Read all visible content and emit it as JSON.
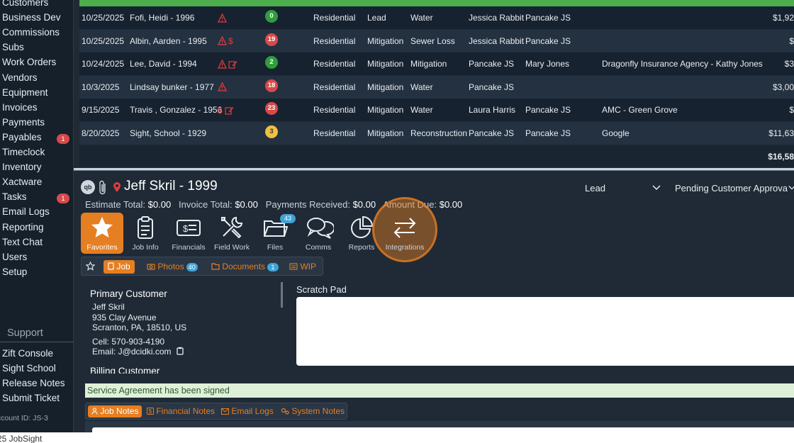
{
  "sidebar": {
    "items": [
      {
        "label": "Customers"
      },
      {
        "label": "Business Dev"
      },
      {
        "label": "Commissions"
      },
      {
        "label": "Subs"
      },
      {
        "label": "Work Orders"
      },
      {
        "label": "Vendors"
      },
      {
        "label": "Equipment"
      },
      {
        "label": "Invoices"
      },
      {
        "label": "Payments"
      },
      {
        "label": "Payables",
        "badge": "1"
      },
      {
        "label": "Timeclock"
      },
      {
        "label": "Inventory"
      },
      {
        "label": "Xactware"
      },
      {
        "label": "Tasks",
        "badge": "1"
      },
      {
        "label": "Email Logs"
      },
      {
        "label": "Reporting"
      },
      {
        "label": "Text Chat"
      },
      {
        "label": "Users"
      },
      {
        "label": "Setup"
      }
    ],
    "support_heading": "Support",
    "support_items": [
      "Zift Console",
      "Sight School",
      "Release Notes",
      "Submit Ticket"
    ],
    "account_id": "ccount ID:  JS-3"
  },
  "footer": {
    "text": "25 JobSight"
  },
  "table": {
    "rows": [
      {
        "date": "10/25/2025",
        "name": "Fofi, Heidi - 1996",
        "count": "0",
        "count_color": "#2e9e3a",
        "type": "Residential",
        "stage": "Lead",
        "loss": "Water",
        "rep1": "Jessica Rabbit",
        "rep2": "Pancake JS",
        "carrier": "",
        "amount": "$1,92"
      },
      {
        "date": "10/25/2025",
        "name": "Albin, Aarden - 1995",
        "count": "19",
        "count_color": "#d84a4a",
        "type": "Residential",
        "stage": "Mitigation",
        "loss": "Sewer Loss",
        "rep1": "Jessica Rabbit",
        "rep2": "Pancake JS",
        "carrier": "",
        "amount": "$"
      },
      {
        "date": "10/24/2025",
        "name": "Lee, David - 1994",
        "count": "2",
        "count_color": "#2e9e3a",
        "type": "Residential",
        "stage": "Mitigation",
        "loss": "Mitigation",
        "rep1": "Pancake JS",
        "rep2": "Mary Jones",
        "carrier": "Dragonfly Insurance Agency - Kathy Jones",
        "amount": "$3"
      },
      {
        "date": "10/3/2025",
        "name": "Lindsay bunker - 1977",
        "count": "18",
        "count_color": "#d84a4a",
        "type": "Residential",
        "stage": "Mitigation",
        "loss": "Water",
        "rep1": "Pancake JS",
        "rep2": "",
        "carrier": "",
        "amount": "$3,00"
      },
      {
        "date": "9/15/2025",
        "name": "Travis , Gonzalez - 1956",
        "count": "23",
        "count_color": "#d84a4a",
        "type": "Residential",
        "stage": "Mitigation",
        "loss": "Water",
        "rep1": "Laura Harris",
        "rep2": "Pancake JS",
        "carrier": "AMC - Green Grove",
        "amount": "$"
      },
      {
        "date": "8/20/2025",
        "name": "Sight, School - 1929",
        "count": "3",
        "count_color": "#f0c040",
        "type": "Residential",
        "stage": "Mitigation",
        "loss": "Reconstruction",
        "rep1": "Pancake JS",
        "rep2": "Pancake JS",
        "carrier": "Google",
        "amount": "$11,63"
      }
    ],
    "grand_total": "$16,58"
  },
  "job": {
    "title": "Jeff Skril - 1999",
    "qb_label": "qb",
    "status_select": "Lead",
    "substatus_select": "Pending Customer Approva",
    "estimate_label": "Estimate Total:",
    "estimate_value": "$0.00",
    "invoice_label": "Invoice Total:",
    "invoice_value": "$0.00",
    "payments_label": "Payments Received:",
    "payments_value": "$0.00",
    "due_label": "Amount Due:",
    "due_value": "$0.00"
  },
  "toolbar": {
    "favorites": "Favorites",
    "job_info": "Job Info",
    "financials": "Financials",
    "field_work": "Field Work",
    "files": "Files",
    "files_badge": "43",
    "comms": "Comms",
    "reports": "Reports",
    "integrations": "Integrations"
  },
  "subtabs": {
    "job": "Job",
    "photos": "Photos",
    "photos_count": "40",
    "documents": "Documents",
    "documents_count": "1",
    "wip": "WIP"
  },
  "customer": {
    "heading": "Primary Customer",
    "name": "Jeff Skril",
    "street": "935 Clay Avenue",
    "city": "Scranton, PA, 18510, US",
    "cell": "Cell: 570-903-4190",
    "email": "Email: J@dcidki.com",
    "billing_heading": "Billing Customer"
  },
  "scratch_pad": {
    "label": "Scratch Pad"
  },
  "notice": "Service Agreement has been signed",
  "notes_tabs": {
    "job_notes": "Job Notes",
    "financial_notes": "Financial Notes",
    "email_logs": "Email Logs",
    "system_notes": "System Notes"
  },
  "colors": {
    "accent": "#e67e22",
    "success": "#4cae4c",
    "badge_blue": "#3fa3d6",
    "danger": "#d84a4a"
  }
}
